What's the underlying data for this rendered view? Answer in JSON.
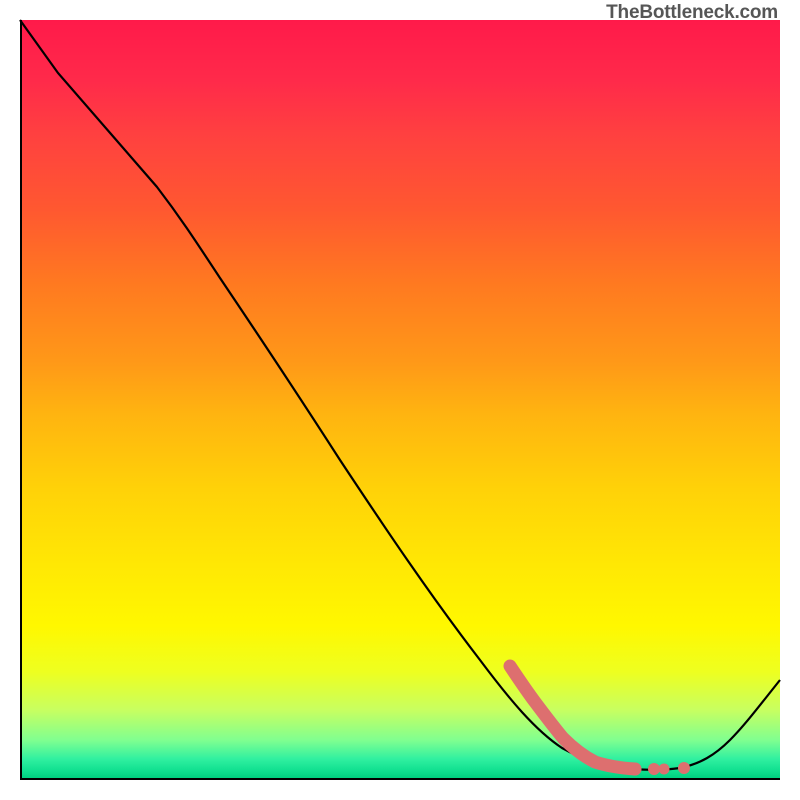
{
  "watermark": "TheBottleneck.com",
  "chart_data": {
    "type": "line",
    "title": "",
    "xlabel": "",
    "ylabel": "",
    "xlim": [
      0,
      100
    ],
    "ylim": [
      0,
      100
    ],
    "grid": false,
    "legend": false,
    "background": "rainbow-gradient (red top → green bottom)",
    "series": [
      {
        "name": "black-curve",
        "color": "#000000",
        "x": [
          0,
          5,
          12,
          18,
          22,
          28,
          35,
          42,
          50,
          58,
          65,
          70,
          74,
          78,
          82,
          86,
          90,
          94,
          100
        ],
        "y": [
          100,
          93,
          85,
          78,
          73,
          64,
          54,
          44,
          33,
          23,
          14,
          8.5,
          5,
          3,
          1.6,
          1.2,
          2.5,
          6.5,
          13.5
        ]
      },
      {
        "name": "salmon-valley-marker",
        "color": "#e07070",
        "style": "thick-stroke-with-dots",
        "x": [
          64.5,
          66,
          67.5,
          69,
          70.5,
          72,
          73.5,
          75,
          76.5,
          78,
          79.5,
          81,
          82.5,
          84,
          86,
          88
        ],
        "y": [
          15,
          12.6,
          10.6,
          8.8,
          7.2,
          5.8,
          4.8,
          4.0,
          3.3,
          2.8,
          2.4,
          2.1,
          1.9,
          1.8,
          1.8,
          1.8
        ]
      }
    ],
    "annotations": []
  }
}
